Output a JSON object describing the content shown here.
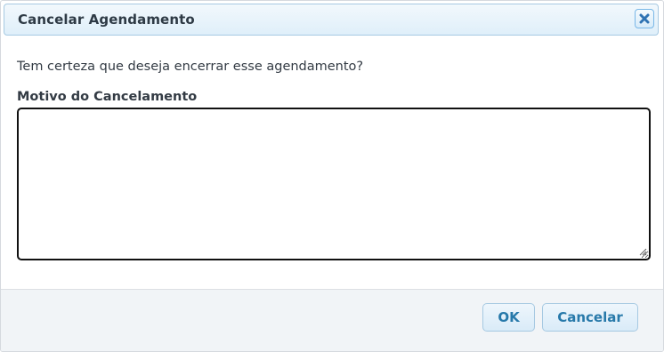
{
  "dialog": {
    "title": "Cancelar Agendamento",
    "close_icon": "close-icon",
    "question": "Tem certeza que deseja encerrar esse agendamento?",
    "reason_label": "Motivo do Cancelamento",
    "reason_value": "",
    "ok_label": "OK",
    "cancel_label": "Cancelar"
  },
  "colors": {
    "title_text": "#2e3a45",
    "button_text": "#2779aa",
    "button_border": "#a6c9e2",
    "titlebar_border": "#a6c9e2",
    "footer_bg": "#f1f4f7",
    "textarea_border": "#111111"
  }
}
